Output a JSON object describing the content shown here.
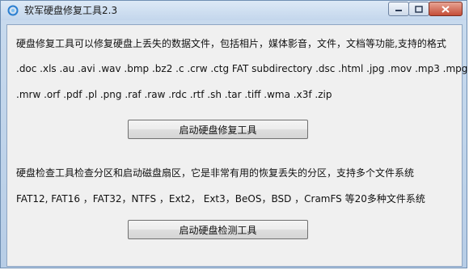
{
  "window": {
    "title": "软军硬盘修复工具2.3",
    "controls": [
      "minimize-icon",
      "maximize-icon",
      "close-icon"
    ]
  },
  "repair": {
    "description": "硬盘修复工具可以修复硬盘上丢失的数据文件，包括相片，媒体影音，文件，文档等功能,支持的格式",
    "formats_line1": ".doc .xls .au .avi .wav .bmp .bz2 .c .crw .ctg FAT subdirectory .dsc .html .jpg .mov .mp3 .mpg",
    "formats_line2": ".mrw .orf .pdf .pl .png .raf .raw .rdc .rtf .sh .tar .tiff .wma .x3f .zip",
    "button_label": "启动硬盘修复工具"
  },
  "check": {
    "description": "硬盘检查工具检查分区和启动磁盘扇区，它是非常有用的恢复丢失的分区，支持多个文件系统",
    "filesystems": "FAT12, FAT16 ，FAT32，NTFS ，Ext2， Ext3，BeOS，BSD ，CramFS 等20多种文件系统",
    "button_label": "启动硬盘检测工具"
  }
}
